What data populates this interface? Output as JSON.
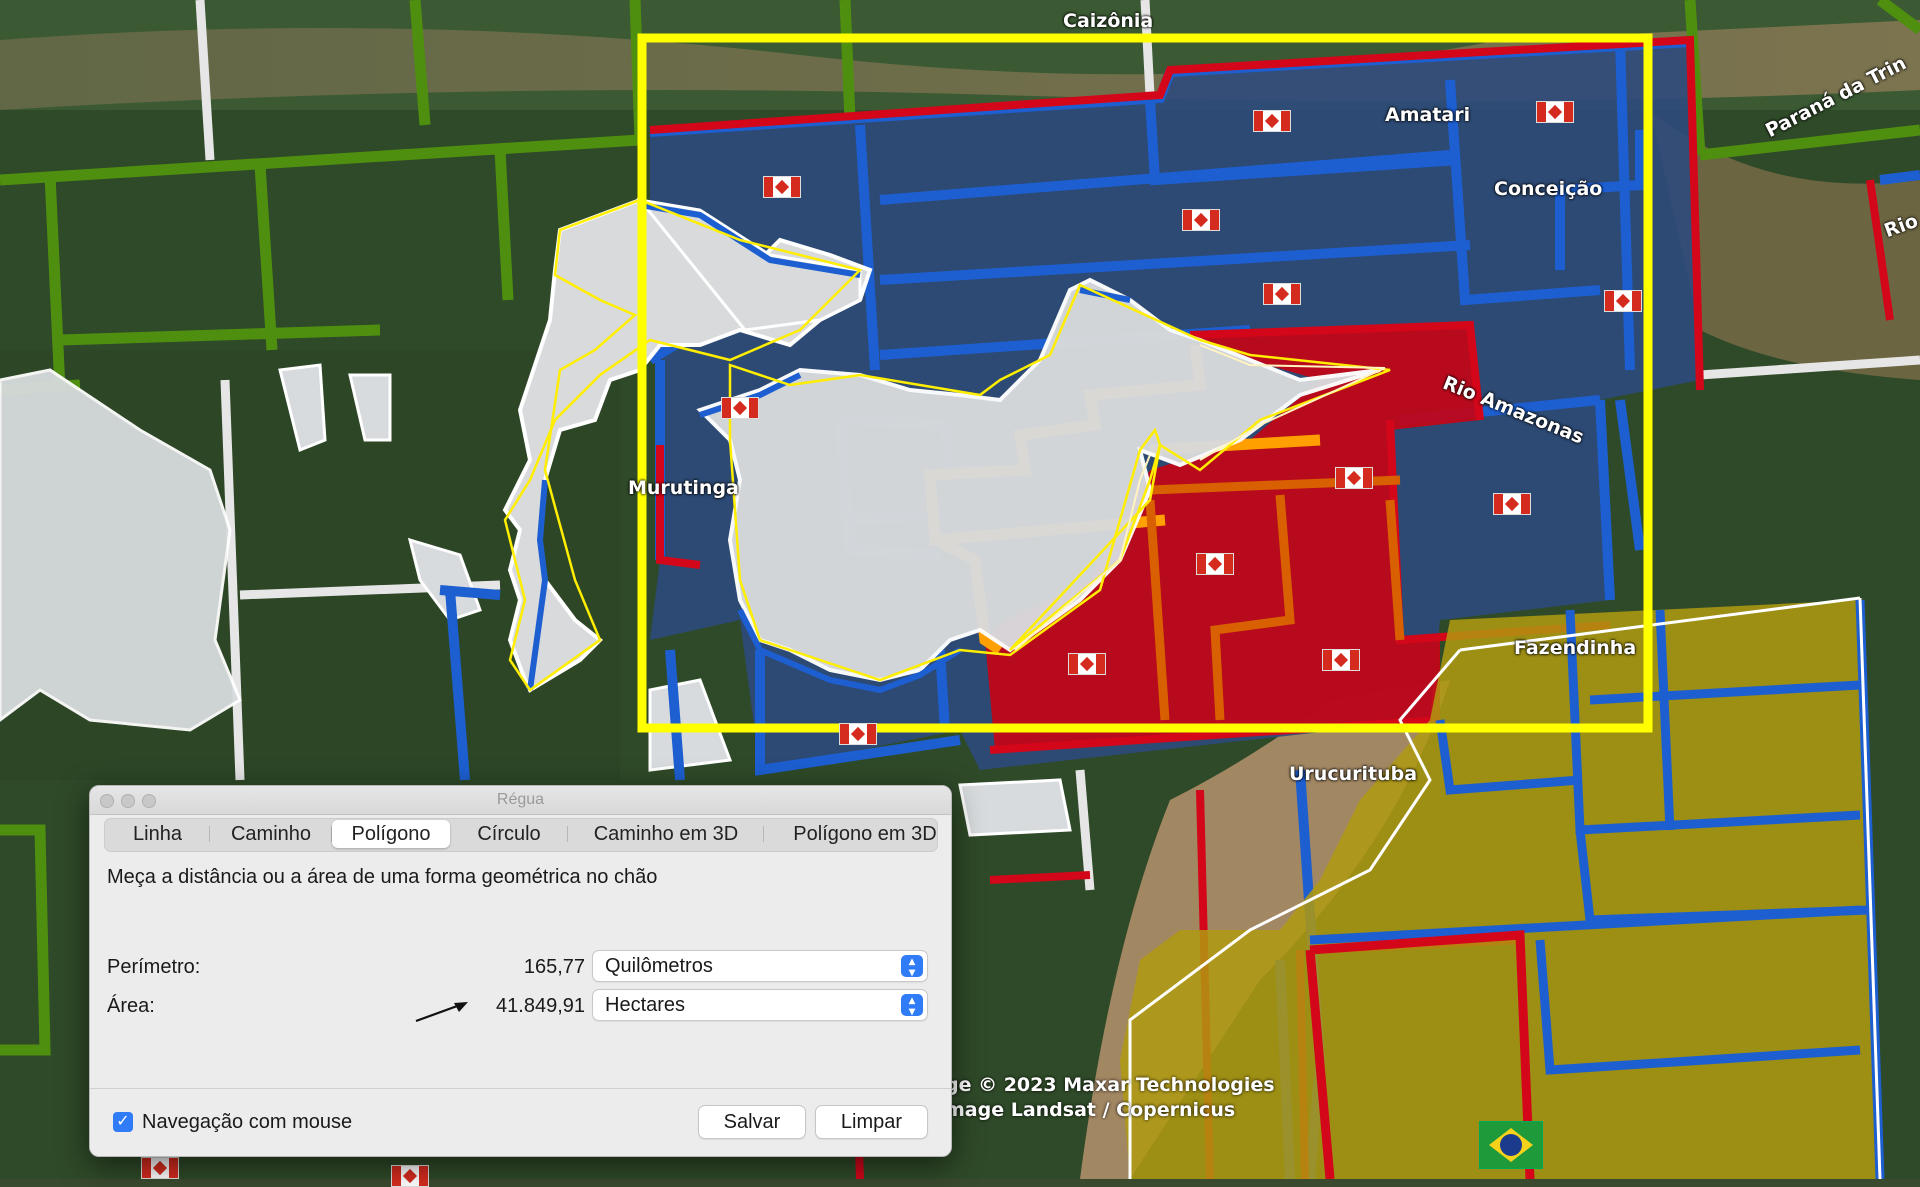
{
  "map": {
    "places": {
      "caizonia": "Caizônia",
      "amatari": "Amatari",
      "conceicao": "Conceição",
      "parana": "Paraná da Trin",
      "rio_right": "Rio",
      "rio_amazonas": "Rio Amazonas",
      "murutinga": "Murutinga",
      "fazendinha": "Fazendinha",
      "urucurituba": "Urucurituba"
    },
    "attribution": {
      "line1": "ge © 2023 Maxar Technologies",
      "line2": "mage Landsat / Copernicus"
    },
    "colors": {
      "highlight_frame": "#ffff00",
      "blue_block": "#1d5fd1",
      "red_block": "#d3061a",
      "yellow_block": "#c8a400",
      "green_lines": "#4f8f10",
      "orange_lines": "#ffa000"
    }
  },
  "ruler": {
    "window_title": "Régua",
    "tabs": [
      "Linha",
      "Caminho",
      "Polígono",
      "Círculo",
      "Caminho em 3D",
      "Polígono em 3D"
    ],
    "selected_tab": "Polígono",
    "description": "Meça a distância ou a área de uma forma geométrica no chão",
    "perimeter_label": "Perímetro:",
    "perimeter_value": "165,77",
    "perimeter_unit": "Quilômetros",
    "area_label": "Área:",
    "area_value": "41.849,91",
    "area_unit": "Hectares",
    "mouse_nav_label": "Navegação com mouse",
    "mouse_nav_checked": true,
    "save_label": "Salvar",
    "clear_label": "Limpar"
  }
}
